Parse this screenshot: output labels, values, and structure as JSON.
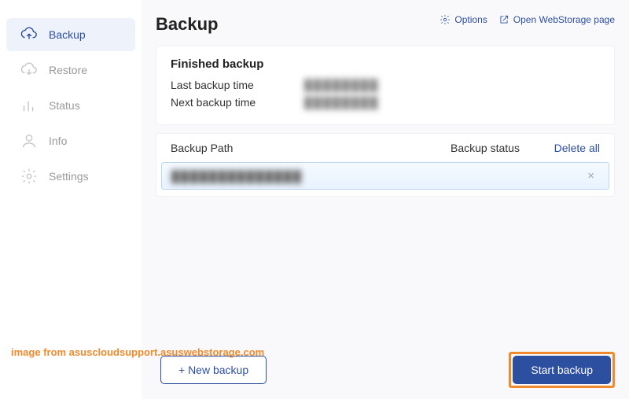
{
  "sidebar": {
    "items": [
      {
        "label": "Backup"
      },
      {
        "label": "Restore"
      },
      {
        "label": "Status"
      },
      {
        "label": "Info"
      },
      {
        "label": "Settings"
      }
    ]
  },
  "header": {
    "title": "Backup",
    "options_label": "Options",
    "open_web_label": "Open WebStorage page"
  },
  "finished": {
    "title": "Finished backup",
    "last_label": "Last backup time",
    "last_value": "████████",
    "next_label": "Next backup time",
    "next_value": "████████"
  },
  "list": {
    "col_path": "Backup Path",
    "col_status": "Backup status",
    "delete_all": "Delete all",
    "rows": [
      {
        "path": "██████████████",
        "close": "×"
      }
    ]
  },
  "actions": {
    "new_backup": "+ New  backup",
    "start_backup": "Start backup"
  },
  "watermark": "image from asuscloudsupport.asuswebstorage.com"
}
